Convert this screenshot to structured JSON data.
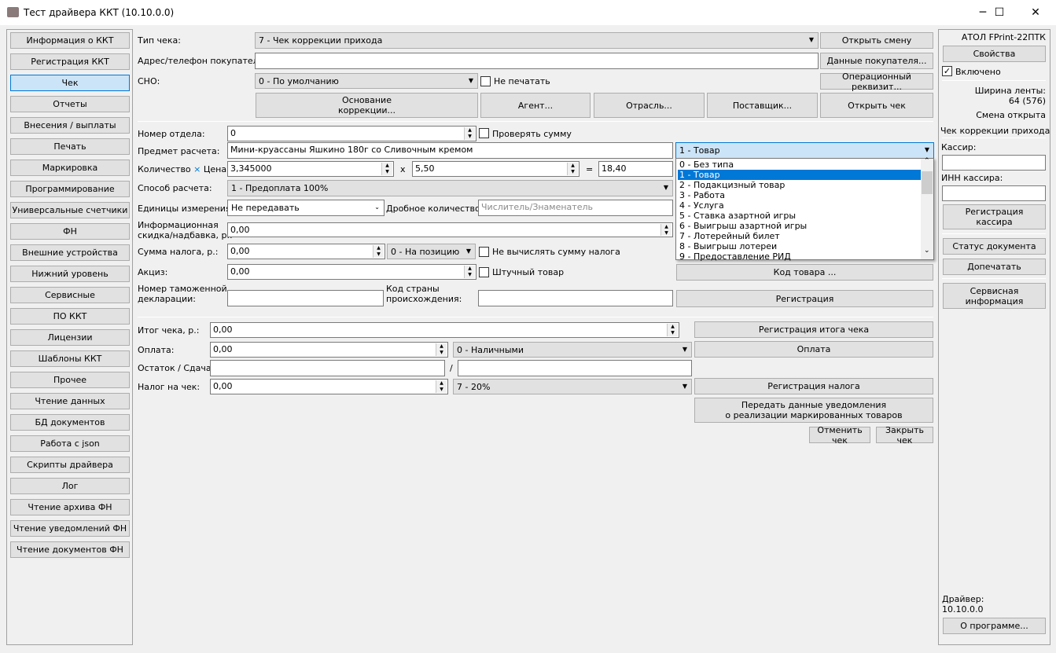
{
  "window": {
    "title": "Тест драйвера ККТ (10.10.0.0)",
    "minimize": "─",
    "maximize": "☐",
    "close": "✕"
  },
  "sidebar": {
    "items": [
      "Информация о ККТ",
      "Регистрация ККТ",
      "Чек",
      "Отчеты",
      "Внесения / выплаты",
      "Печать",
      "Маркировка",
      "Программирование",
      "Универсальные счетчики",
      "ФН",
      "Внешние устройства",
      "Нижний уровень",
      "Сервисные",
      "ПО ККТ",
      "Лицензии",
      "Шаблоны ККТ",
      "Прочее",
      "Чтение данных",
      "БД документов",
      "Работа с json",
      "Скрипты драйвера",
      "Лог",
      "Чтение архива ФН",
      "Чтение уведомлений ФН",
      "Чтение документов ФН"
    ],
    "selected": "Чек"
  },
  "receipt": {
    "type_label": "Тип чека:",
    "type_value": "7 - Чек коррекции прихода",
    "open_shift": "Открыть смену",
    "buyer_label": "Адрес/телефон покупателя:",
    "buyer_value": "",
    "buyer_data": "Данные покупателя...",
    "sno_label": "СНО:",
    "sno_value": "0 - По умолчанию",
    "no_print": "Не печатать",
    "op_req": "Операционный реквизит...",
    "basis": "Основание\nкоррекции...",
    "agent": "Агент...",
    "industry": "Отрасль...",
    "supplier": "Поставщик...",
    "open_receipt": "Открыть чек"
  },
  "position": {
    "dept_label": "Номер отдела:",
    "dept_value": "0",
    "check_sum": "Проверять сумму",
    "subject_label": "Предмет расчета:",
    "subject_value": "Мини-круассаны Яшкино 180г со Сливочным кремом",
    "subject_type": "1 - Товар",
    "subject_type_options": [
      "0 - Без типа",
      "1 - Товар",
      "2 - Подакцизный товар",
      "3 - Работа",
      "4 - Услуга",
      "5 - Ставка азартной игры",
      "6 - Выигрыш азартной игры",
      "7 - Лотерейный билет",
      "8 - Выигрыш лотереи",
      "9 - Предоставление РИД"
    ],
    "qty_label": "Количество",
    "times": "×",
    "price_label": "Цена:",
    "qty_value": "3,345000",
    "x": "x",
    "price_value": "5,50",
    "eq": "=",
    "sum_value": "18,40",
    "method_label": "Способ расчета:",
    "method_value": "1 - Предоплата 100%",
    "units_label": "Единицы измерения:",
    "units_value": "Не передавать",
    "fraction_label": "Дробное количество:",
    "fraction_placeholder": "Числитель/Знаменатель",
    "discount_label": "Информационная\nскидка/надбавка, р.:",
    "discount_value": "0,00",
    "tax_label": "Сумма налога, р.:",
    "tax_value": "0,00",
    "tax_mode": "0 - На позицию",
    "no_calc_tax": "Не вычислять сумму налога",
    "excise_label": "Акциз:",
    "excise_value": "0,00",
    "piece": "Штучный товар",
    "product_code": "Код товара ...",
    "customs_label": "Номер таможенной\nдекларации:",
    "customs_value": "",
    "country_label": "Код страны\nпроисхождения:",
    "country_value": "",
    "register": "Регистрация"
  },
  "totals": {
    "total_label": "Итог чека, р.:",
    "total_value": "0,00",
    "register_total": "Регистрация итога чека",
    "payment_label": "Оплата:",
    "payment_value": "0,00",
    "payment_type": "0 - Наличными",
    "payment": "Оплата",
    "change_label": "Остаток / Сдача:",
    "remainder": "",
    "slash": "/",
    "change": "",
    "tax_label": "Налог на чек:",
    "tax_value": "0,00",
    "tax_type": "7 - 20%",
    "register_tax": "Регистрация налога",
    "send_notice": "Передать данные уведомления\nо реализации маркированных товаров",
    "cancel": "Отменить чек",
    "close": "Закрыть чек"
  },
  "right": {
    "model": "АТОЛ FPrint-22ПТК",
    "properties": "Свойства",
    "enabled": "Включено",
    "enabled_checked": true,
    "tape_label": "Ширина ленты:",
    "tape_value": "64 (576)",
    "shift": "Смена открыта",
    "doc": "Чек коррекции прихода",
    "cashier_label": "Кассир:",
    "cashier": "",
    "inn_label": "ИНН кассира:",
    "inn": "",
    "reg_cashier": "Регистрация\nкассира",
    "doc_status": "Статус документа",
    "reprint": "Допечатать",
    "service": "Сервисная\nинформация",
    "driver_label": "Драйвер:",
    "driver_version": "10.10.0.0",
    "about": "О программе..."
  },
  "colors": {
    "selected": "#cce4f7",
    "accent": "#0078d7",
    "face": "#f0f0f0"
  }
}
